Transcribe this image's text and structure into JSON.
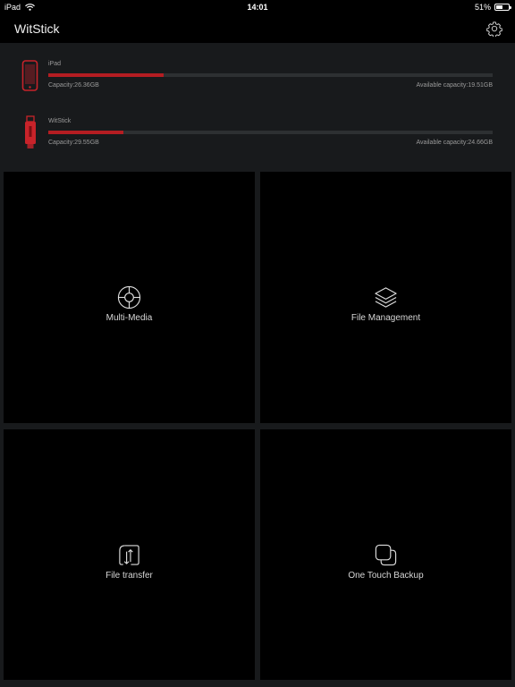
{
  "status_bar": {
    "carrier": "iPad",
    "time": "14:01",
    "battery_percent": "51%",
    "battery_level": 0.51,
    "wifi_icon": "wifi-icon",
    "battery_icon": "battery-icon"
  },
  "nav": {
    "title": "WitStick",
    "settings_icon": "gear-icon"
  },
  "devices": [
    {
      "name": "iPad",
      "icon": "tablet-icon",
      "capacity": "Capacity:26.36GB",
      "available": "Available capacity:19.51GB",
      "used_fraction": 0.26
    },
    {
      "name": "WitStick",
      "icon": "usb-stick-icon",
      "capacity": "Capacity:29.55GB",
      "available": "Available capacity:24.66GB",
      "used_fraction": 0.17
    }
  ],
  "tiles": [
    {
      "label": "Multi-Media",
      "icon": "aperture-icon"
    },
    {
      "label": "File Management",
      "icon": "layers-icon"
    },
    {
      "label": "File transfer",
      "icon": "transfer-icon"
    },
    {
      "label": "One Touch Backup",
      "icon": "backup-icon"
    }
  ],
  "colors": {
    "background": "#000000",
    "panel": "#181a1c",
    "accent": "#b41d22",
    "track": "#2d3032"
  }
}
